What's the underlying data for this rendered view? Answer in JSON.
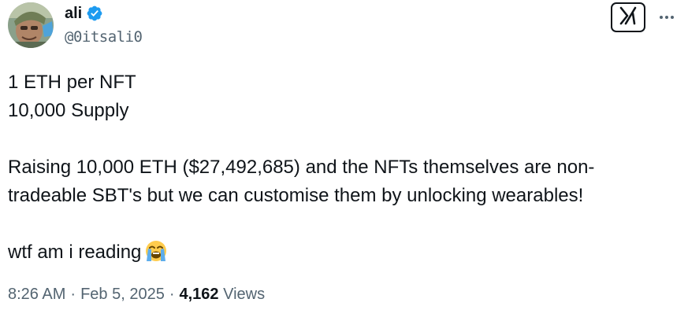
{
  "author": {
    "display_name": "ali",
    "handle": "@0itsali0",
    "verified_icon": "verified-badge-icon",
    "avatar": "avatar"
  },
  "actions": {
    "grok_icon": "grok-icon",
    "more_icon": "more-horizontal-icon"
  },
  "tweet": {
    "lines": [
      "1 ETH per NFT",
      "10,000 Supply",
      "Raising 10,000 ETH ($27,492,685) and the NFTs themselves are non-",
      "tradeable SBT's but we can customise them by unlocking wearables!",
      "wtf am i reading"
    ],
    "emoji_icon": "loudly-crying-face-icon"
  },
  "meta": {
    "time": "8:26 AM",
    "separator": "·",
    "date": "Feb 5, 2025",
    "views_count": "4,162",
    "views_label": "Views"
  },
  "colors": {
    "text_primary": "#0f1419",
    "text_secondary": "#536471",
    "verified_blue": "#1d9bf0",
    "background": "#ffffff"
  }
}
